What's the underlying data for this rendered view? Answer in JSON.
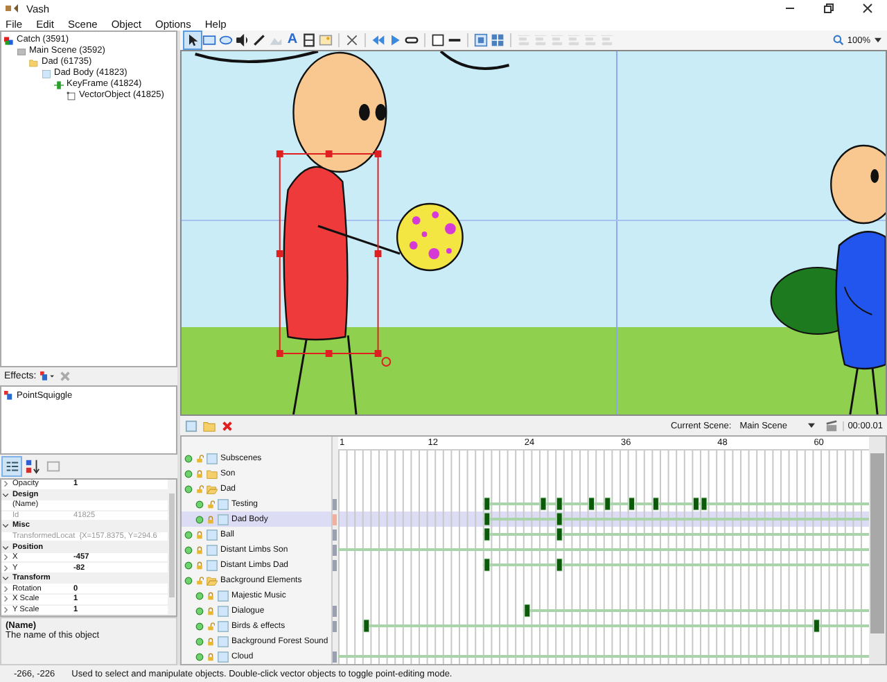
{
  "window": {
    "title": "Vash"
  },
  "menu": [
    "File",
    "Edit",
    "Scene",
    "Object",
    "Options",
    "Help"
  ],
  "scene_tree": [
    {
      "label": "Catch (3591)",
      "kind": "project",
      "children": [
        {
          "label": "Main Scene (3592)",
          "kind": "scene",
          "children": [
            {
              "label": "Dad (61735)",
              "kind": "folder",
              "children": [
                {
                  "label": "Dad Body (41823)",
                  "kind": "layer",
                  "children": [
                    {
                      "label": "KeyFrame (41824)",
                      "kind": "keyframe",
                      "children": [
                        {
                          "label": "VectorObject (41825)",
                          "kind": "vector"
                        }
                      ]
                    }
                  ]
                }
              ]
            }
          ]
        }
      ]
    }
  ],
  "effects": {
    "label": "Effects:",
    "items": [
      "PointSquiggle"
    ]
  },
  "properties": {
    "rows": [
      {
        "kind": "row",
        "name": "Opacity",
        "value": "1",
        "expandable": true,
        "disabled": false
      },
      {
        "kind": "category",
        "name": "Design",
        "expanded": true
      },
      {
        "kind": "row",
        "name": "(Name)",
        "value": "",
        "expandable": false,
        "disabled": false
      },
      {
        "kind": "row",
        "name": "Id",
        "value": "41825",
        "expandable": false,
        "disabled": true
      },
      {
        "kind": "category",
        "name": "Misc",
        "expanded": true
      },
      {
        "kind": "row",
        "name": "TransformedLocat",
        "value": "{X=157.8375, Y=294.6",
        "expandable": false,
        "disabled": true
      },
      {
        "kind": "category",
        "name": "Position",
        "expanded": true
      },
      {
        "kind": "row",
        "name": "X",
        "value": "-457",
        "expandable": true,
        "disabled": false
      },
      {
        "kind": "row",
        "name": "Y",
        "value": "-82",
        "expandable": true,
        "disabled": false
      },
      {
        "kind": "category",
        "name": "Transform",
        "expanded": true
      },
      {
        "kind": "row",
        "name": "Rotation",
        "value": "0",
        "expandable": true,
        "disabled": false
      },
      {
        "kind": "row",
        "name": "X Scale",
        "value": "1",
        "expandable": true,
        "disabled": false
      },
      {
        "kind": "row",
        "name": "Y Scale",
        "value": "1",
        "expandable": true,
        "disabled": false
      }
    ],
    "description": {
      "title": "(Name)",
      "text": "The name of this object"
    }
  },
  "toolbar": {
    "tools": [
      {
        "kind": "pointer",
        "selected": true,
        "disabled": false
      },
      {
        "kind": "rect",
        "selected": false,
        "disabled": false
      },
      {
        "kind": "ellipse",
        "selected": false,
        "disabled": false
      },
      {
        "kind": "sound",
        "selected": false,
        "disabled": false
      },
      {
        "kind": "pen",
        "selected": false,
        "disabled": false
      },
      {
        "kind": "shape",
        "selected": false,
        "disabled": true
      },
      {
        "kind": "text",
        "glyph": "A",
        "selected": false,
        "disabled": false
      },
      {
        "kind": "film",
        "selected": false,
        "disabled": false
      },
      {
        "kind": "picture",
        "selected": false,
        "disabled": false
      },
      {
        "kind": "separator"
      },
      {
        "kind": "cut",
        "selected": false,
        "disabled": false
      },
      {
        "kind": "separator"
      },
      {
        "kind": "rewind",
        "selected": false,
        "disabled": false
      },
      {
        "kind": "play",
        "selected": false,
        "disabled": false
      },
      {
        "kind": "loop",
        "selected": false,
        "disabled": false
      },
      {
        "kind": "separator"
      },
      {
        "kind": "box",
        "selected": false,
        "disabled": false
      },
      {
        "kind": "line",
        "selected": false,
        "disabled": false
      },
      {
        "kind": "separator"
      },
      {
        "kind": "group",
        "selected": false,
        "disabled": false
      },
      {
        "kind": "ungroup",
        "selected": false,
        "disabled": false
      },
      {
        "kind": "separator"
      },
      {
        "kind": "align",
        "selected": false,
        "disabled": true
      },
      {
        "kind": "align",
        "selected": false,
        "disabled": true
      },
      {
        "kind": "align",
        "selected": false,
        "disabled": true
      },
      {
        "kind": "align",
        "selected": false,
        "disabled": true
      },
      {
        "kind": "align",
        "selected": false,
        "disabled": true
      },
      {
        "kind": "align",
        "selected": false,
        "disabled": true
      }
    ],
    "zoom": "100%"
  },
  "timeline": {
    "current_scene_label": "Current Scene:",
    "current_scene": "Main Scene",
    "time": "00:00.01",
    "ruler": [
      "1",
      "12",
      "24",
      "36",
      "48",
      "60"
    ],
    "rows": [
      {
        "label": "Subscenes",
        "kind": "layer",
        "locked": false,
        "selected": false,
        "track": false
      },
      {
        "label": "Son",
        "kind": "folder",
        "locked": true,
        "selected": false,
        "track": false
      },
      {
        "label": "Dad",
        "kind": "open-folder",
        "locked": false,
        "selected": false,
        "track": false,
        "children": [
          {
            "label": "Testing",
            "kind": "layer",
            "locked": false,
            "selected": false,
            "track": true
          },
          {
            "label": "Dad Body",
            "kind": "layer",
            "locked": true,
            "selected": true,
            "track": true
          }
        ]
      },
      {
        "label": "Ball",
        "kind": "layer",
        "locked": true,
        "selected": false,
        "track": true
      },
      {
        "label": "Distant Limbs Son",
        "kind": "layer",
        "locked": true,
        "selected": false,
        "track": true
      },
      {
        "label": "Distant Limbs Dad",
        "kind": "layer",
        "locked": true,
        "selected": false,
        "track": true
      },
      {
        "label": "Background Elements",
        "kind": "open-folder",
        "locked": false,
        "selected": false,
        "track": false,
        "children": [
          {
            "label": "Majestic Music",
            "kind": "layer",
            "locked": true,
            "selected": false,
            "track": false
          },
          {
            "label": "Dialogue",
            "kind": "layer",
            "locked": true,
            "selected": false,
            "track": true
          },
          {
            "label": "Birds & effects",
            "kind": "layer",
            "locked": false,
            "selected": false,
            "track": true
          },
          {
            "label": "Background Forest Sound",
            "kind": "layer",
            "locked": true,
            "selected": false,
            "track": false
          },
          {
            "label": "Cloud",
            "kind": "layer",
            "locked": true,
            "selected": false,
            "track": true
          }
        ]
      }
    ]
  },
  "status_bar": {
    "coordinates": "-266, -226",
    "message": "Used to select and manipulate objects. Double-click vector objects to toggle point-editing mode."
  }
}
